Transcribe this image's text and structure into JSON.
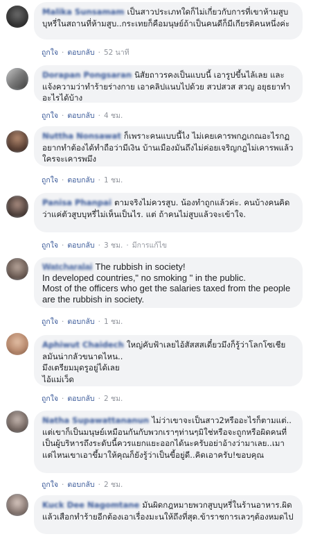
{
  "comments": [
    {
      "author": "Malika Sunsamam",
      "text": "เป็นสาวประเภทใดก็ไม่เกี่ยวกับการที่เขาห้ามสูบบุหรี่ในสถานที่ห้ามสูบ..กระเทยก็คือมนุษย์ถ้าเป็นคนดีก็มีเกียรติคนหนึ่งค่ะ",
      "like": "ถูกใจ",
      "reply": "ตอบกลับ",
      "time": "52 นาที",
      "edited": ""
    },
    {
      "author": "Dorapan Pongsaran",
      "text": "นิสัยถาวรคงเป็นแบบนี้ เอารูปขึ้นไล้เลย และแจ้งความว่าทำร้ายร่างกาย เอาคลิปแนบไปด้วย สวปสวส สวญ อยุธยาทำอะไรได้บ้าง",
      "like": "ถูกใจ",
      "reply": "ตอบกลับ",
      "time": "4 ชม.",
      "edited": ""
    },
    {
      "author": "Nuttha Nonsawat",
      "text": "ก็เพราะคนแบบนี้ไง ไม่เคยเคารพกฎเกณอะไรกฏอยากทำต้องได้ทำถือว่ามีเงิน บ้านเมืองมันถึงไม่ค่อยเจริญกฎไม่เคารพแล้วใครจะเคารพมึง",
      "like": "ถูกใจ",
      "reply": "ตอบกลับ",
      "time": "1 ชม.",
      "edited": ""
    },
    {
      "author": "Panisa Phanpai",
      "text": "ตามจริงไม่ควรสูบ. น้องทำถูกแล้วค่ะ. คนบ้างคนคิดว่าแค่ตัวสูบบุหรี่ไม่เห็นเป็นไร. แต่ ถ้าคนไม่สูบแล้วจะเข้าใจ.",
      "like": "ถูกใจ",
      "reply": "ตอบกลับ",
      "time": "3 ชม.",
      "edited": "มีการแก้ไข"
    },
    {
      "author": "Watcharalai",
      "text": "The rubbish in society!\nIn developed countries,\" no smoking \" in the public.\nMost of the officers who get the salaries taxed from the people are the rubbish in society.",
      "like": "ถูกใจ",
      "reply": "ตอบกลับ",
      "time": "1 ชม.",
      "edited": ""
    },
    {
      "author": "Aphiwut Chaidech",
      "text": "ใหญ่คับฟ้าเลยไอ้สัสสสเดี๋ยวมึงก็รู้ว่าโลกโซเชียลมันน่ากลัวขนาดไหน..\nมึงเตรียมมุดรูอยู่ได้เลย\nไอ้แม่เว็ด",
      "like": "ถูกใจ",
      "reply": "ตอบกลับ",
      "time": "2 ชม.",
      "edited": ""
    },
    {
      "author": "Natha Supawattananun",
      "text": "ไม่ว่าเขาจะเป็นสาว2หรืออะไรก็ตามแต่.. แต่เขาก็เป็นมนุษย์เหมือนกันกับพวกเราๆท่านๆมิใช่หรือจะถูกหรือผิดคนที่เป็นผู้บริหารถึงระดับนี้ควรแยกแยะออกได้นะครับอย่าอ้างว่ามาเลย..เมาแต่ไหนเขาเอาขึ้มาให้คุณก็ยังรู้ว่าเป็นขี้อยู่ดี..คิดเอาครับ!ขอบคุณ",
      "like": "ถูกใจ",
      "reply": "ตอบกลับ",
      "time": "2 ชม.",
      "edited": ""
    },
    {
      "author": "Kuck Dee Nagomtane",
      "text": "มันผิดกฎหมายพวกสูบบุหรี่ในร้านอาหาร.ผิดแล้วเสือกทำร้ายอีกต้องเอาเรื่องมะนให้ถึงที่สุด.ข้าราชการเลวๆต้องหมดไป",
      "like": "",
      "reply": "",
      "time": "",
      "edited": ""
    }
  ]
}
